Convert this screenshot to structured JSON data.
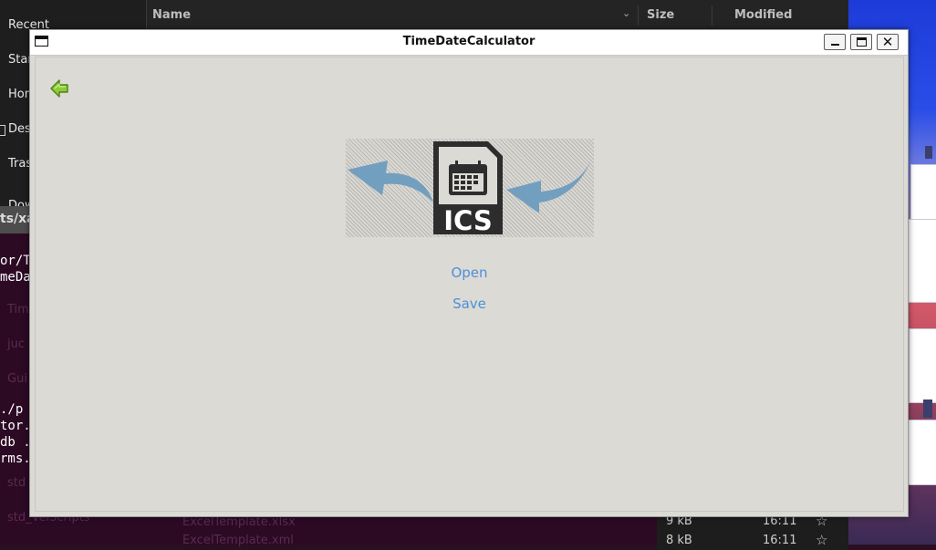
{
  "window": {
    "title": "TimeDateCalculator"
  },
  "dialog": {
    "back_icon": "arrow-left-icon",
    "image_icon": "ics-file-icon",
    "image_text": "ICS",
    "open_label": "Open",
    "save_label": "Save"
  },
  "file_manager": {
    "sidebar": [
      "Recent",
      "Star",
      "Hon",
      "Des",
      "Tras",
      "Dow"
    ],
    "columns": {
      "name": "Name",
      "size": "Size",
      "modified": "Modified"
    },
    "bottom_rows": [
      {
        "size": "9 kB",
        "time": "16:11"
      },
      {
        "size": "8 kB",
        "time": "16:11"
      }
    ],
    "bottom_files": [
      "ExcelTemplate.xlsx",
      "ExcelTemplate.xml"
    ]
  },
  "terminal": {
    "tab_label": "ts/xa",
    "lines": [
      "or/T",
      "meDa",
      "./p",
      "tor.",
      "db .",
      "rms."
    ],
    "dim_lines": [
      "Tim",
      "juc",
      "Gui",
      "std",
      "std_VelScripts"
    ]
  },
  "colors": {
    "link": "#4a90d9",
    "arrow_green": "#7ab828",
    "ics_arrows": "#6e9cbf"
  }
}
